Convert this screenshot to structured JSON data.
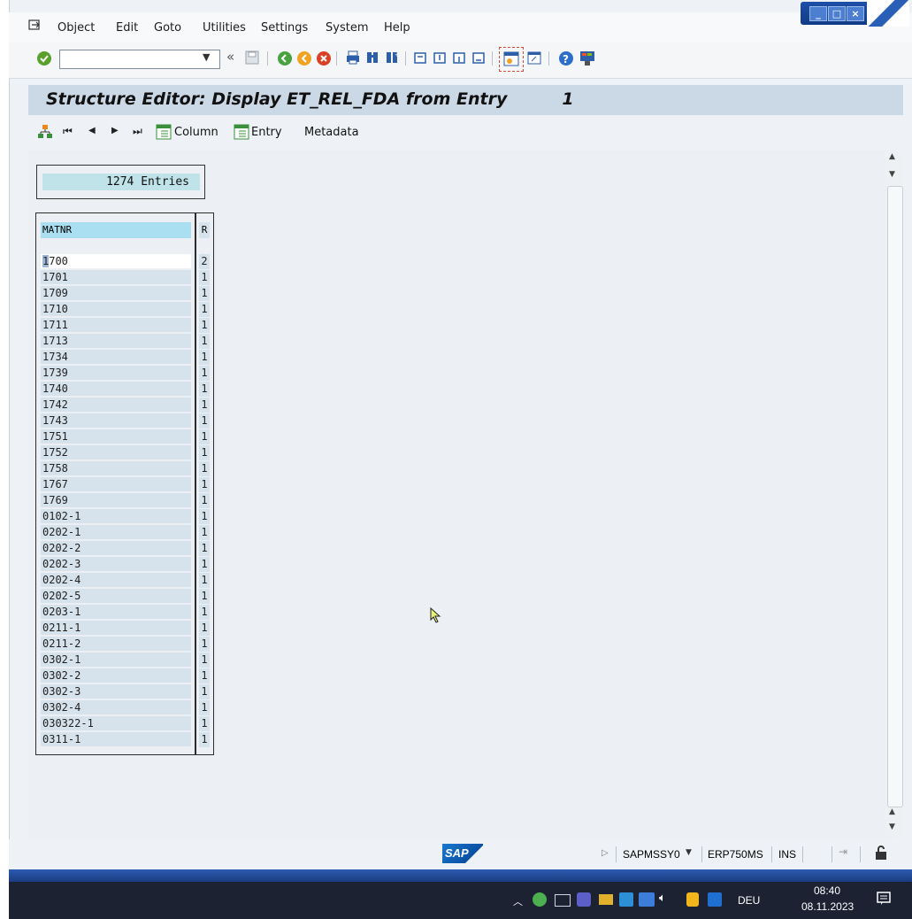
{
  "menu": {
    "items": [
      "Object",
      "Edit",
      "Goto",
      "Utilities",
      "Settings",
      "System",
      "Help"
    ]
  },
  "toolbar": {
    "command_value": ""
  },
  "title": {
    "text": "Structure Editor: Display ET_REL_FDA from Entry",
    "entry": "1"
  },
  "appbar": {
    "column_label": "Column",
    "entry_label": "Entry",
    "metadata_label": "Metadata"
  },
  "entries": {
    "text": "1274 Entries"
  },
  "grid": {
    "headers": [
      "MATNR",
      "R"
    ],
    "rows": [
      {
        "matnr": "1700",
        "r": "2"
      },
      {
        "matnr": "1701",
        "r": "1"
      },
      {
        "matnr": "1709",
        "r": "1"
      },
      {
        "matnr": "1710",
        "r": "1"
      },
      {
        "matnr": "1711",
        "r": "1"
      },
      {
        "matnr": "1713",
        "r": "1"
      },
      {
        "matnr": "1734",
        "r": "1"
      },
      {
        "matnr": "1739",
        "r": "1"
      },
      {
        "matnr": "1740",
        "r": "1"
      },
      {
        "matnr": "1742",
        "r": "1"
      },
      {
        "matnr": "1743",
        "r": "1"
      },
      {
        "matnr": "1751",
        "r": "1"
      },
      {
        "matnr": "1752",
        "r": "1"
      },
      {
        "matnr": "1758",
        "r": "1"
      },
      {
        "matnr": "1767",
        "r": "1"
      },
      {
        "matnr": "1769",
        "r": "1"
      },
      {
        "matnr": "0102-1",
        "r": "1"
      },
      {
        "matnr": "0202-1",
        "r": "1"
      },
      {
        "matnr": "0202-2",
        "r": "1"
      },
      {
        "matnr": "0202-3",
        "r": "1"
      },
      {
        "matnr": "0202-4",
        "r": "1"
      },
      {
        "matnr": "0202-5",
        "r": "1"
      },
      {
        "matnr": "0203-1",
        "r": "1"
      },
      {
        "matnr": "0211-1",
        "r": "1"
      },
      {
        "matnr": "0211-2",
        "r": "1"
      },
      {
        "matnr": "0302-1",
        "r": "1"
      },
      {
        "matnr": "0302-2",
        "r": "1"
      },
      {
        "matnr": "0302-3",
        "r": "1"
      },
      {
        "matnr": "0302-4",
        "r": "1"
      },
      {
        "matnr": "030322-1",
        "r": "1"
      },
      {
        "matnr": "0311-1",
        "r": "1"
      }
    ]
  },
  "status": {
    "sap_logo": "SAP",
    "program": "SAPMSSY0",
    "system": "ERP750MS",
    "mode": "INS"
  },
  "taskbar": {
    "lang": "DEU",
    "time": "08:40",
    "date": "08.11.2023"
  },
  "colors": {
    "title_bg": "#cbd8e6",
    "header_cell": "#a9dff0",
    "row_cell": "#d6e2ec",
    "taskbar": "#1c2232"
  }
}
